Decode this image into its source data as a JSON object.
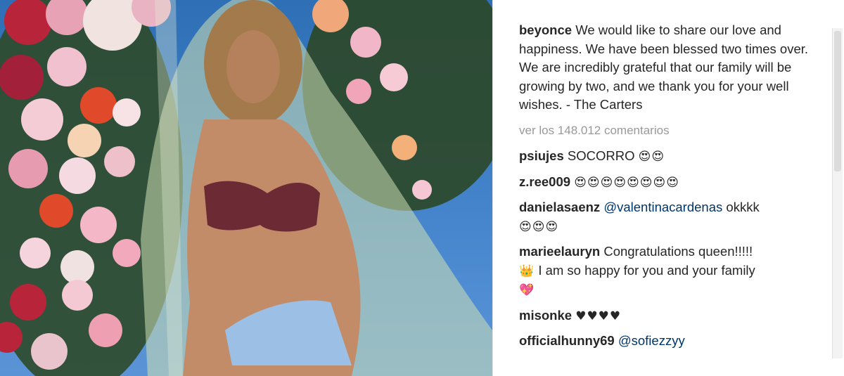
{
  "post": {
    "photo_alt": "beyonce post photo",
    "caption": {
      "username": "beyonce",
      "text": "We would like to share our love and happiness. We have been blessed two times over. We are incredibly grateful that our family will be growing by two, and we thank you for your well wishes. - The Carters"
    },
    "view_all_comments": "ver los 148.012 comentarios",
    "comments": [
      {
        "username": "psiujes",
        "text": "SOCORRO",
        "mention": "",
        "emoji": "😍😍"
      },
      {
        "username": "z.ree009",
        "text": "",
        "mention": "",
        "emoji": "😍😍😍😍😍😍😍😍"
      },
      {
        "username": "danielasaenz",
        "text": "okkkk",
        "mention": "@valentinacardenas",
        "emoji": "😍😍😍"
      },
      {
        "username": "marieelauryn",
        "text": "Congratulations queen!!!!!",
        "text2": "I am so happy for you and your family",
        "mention": "",
        "emoji": "👑",
        "emoji2": "💖"
      },
      {
        "username": "misonke",
        "text": "",
        "mention": "",
        "emoji": "♥♥♥♥"
      },
      {
        "username": "officialhunny69",
        "text": "",
        "mention": "@sofiezzyy",
        "emoji": ""
      }
    ]
  },
  "colors": {
    "sky": "#3a7cc2",
    "username": "#262626",
    "mention": "#003569",
    "muted": "#999999"
  }
}
